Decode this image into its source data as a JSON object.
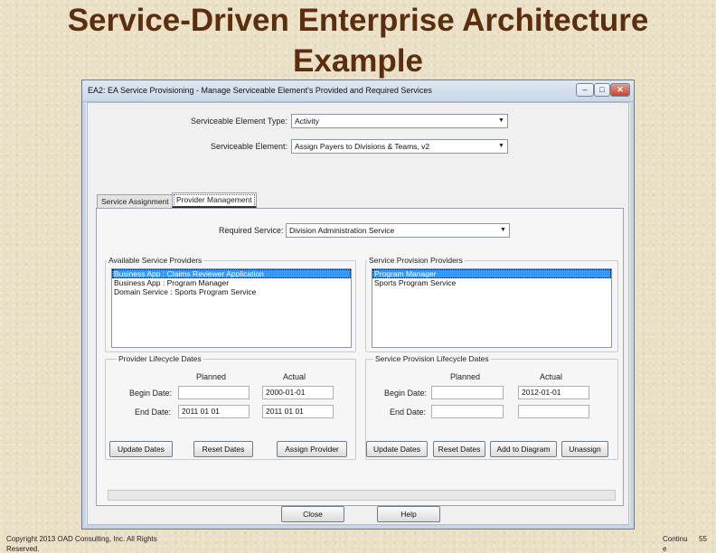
{
  "slide": {
    "title_line1": "Service-Driven Enterprise Architecture",
    "title_line2": "Example",
    "copyright_line1": "Copyright 2013 OAD Consulting, Inc. All Rights",
    "copyright_line2": "Reserved.",
    "continue_line1": "Continu",
    "continue_line2": "e",
    "page_number": "55"
  },
  "window": {
    "title": "EA2: EA Service Provisioning - Manage Serviceable Element's Provided and Required Services",
    "minimize": "–",
    "maximize": "□",
    "close": "✕"
  },
  "form": {
    "element_type_label": "Serviceable Element Type:",
    "element_type_value": "Activity",
    "element_label": "Serviceable Element:",
    "element_value": "Assign Payers to Divisions & Teams, v2"
  },
  "tabs": [
    {
      "label": "Service Assignment"
    },
    {
      "label": "Provider Management"
    }
  ],
  "provider_tab": {
    "required_service_label": "Required Service:",
    "required_service_value": "Division Administration Service",
    "available": {
      "title": "Available Service Providers",
      "items": [
        {
          "label": "Business App : Claims Reviewer Application"
        },
        {
          "label": "Business App : Program Manager"
        },
        {
          "label": "Domain Service : Sports Program Service"
        }
      ]
    },
    "provision": {
      "title": "Service Provision Providers",
      "items": [
        {
          "label": "Program Manager"
        },
        {
          "label": "Sports Program Service"
        }
      ]
    },
    "provider_dates": {
      "title": "Provider Lifecycle Dates",
      "planned_header": "Planned",
      "actual_header": "Actual",
      "begin_label": "Begin Date:",
      "end_label": "End Date:",
      "begin_planned": "",
      "begin_actual": "2000-01-01",
      "end_planned": "2011 01 01",
      "end_actual": "2011 01 01",
      "buttons": [
        "Update Dates",
        "Reset Dates",
        "Assign Provider"
      ]
    },
    "provision_dates": {
      "title": "Service Provision Lifecycle Dates",
      "planned_header": "Planned",
      "actual_header": "Actual",
      "begin_label": "Begin Date:",
      "end_label": "End Date:",
      "begin_planned": "",
      "begin_actual": "2012-01-01",
      "end_planned": "",
      "end_actual": "",
      "buttons": [
        "Update Dates",
        "Reset Dates",
        "Add to Diagram",
        "Unassign"
      ]
    }
  },
  "footer_buttons": {
    "close": "Close",
    "help": "Help"
  },
  "colors": {
    "title_brown": "#5c2e0e",
    "selection_blue": "#3399ff"
  }
}
